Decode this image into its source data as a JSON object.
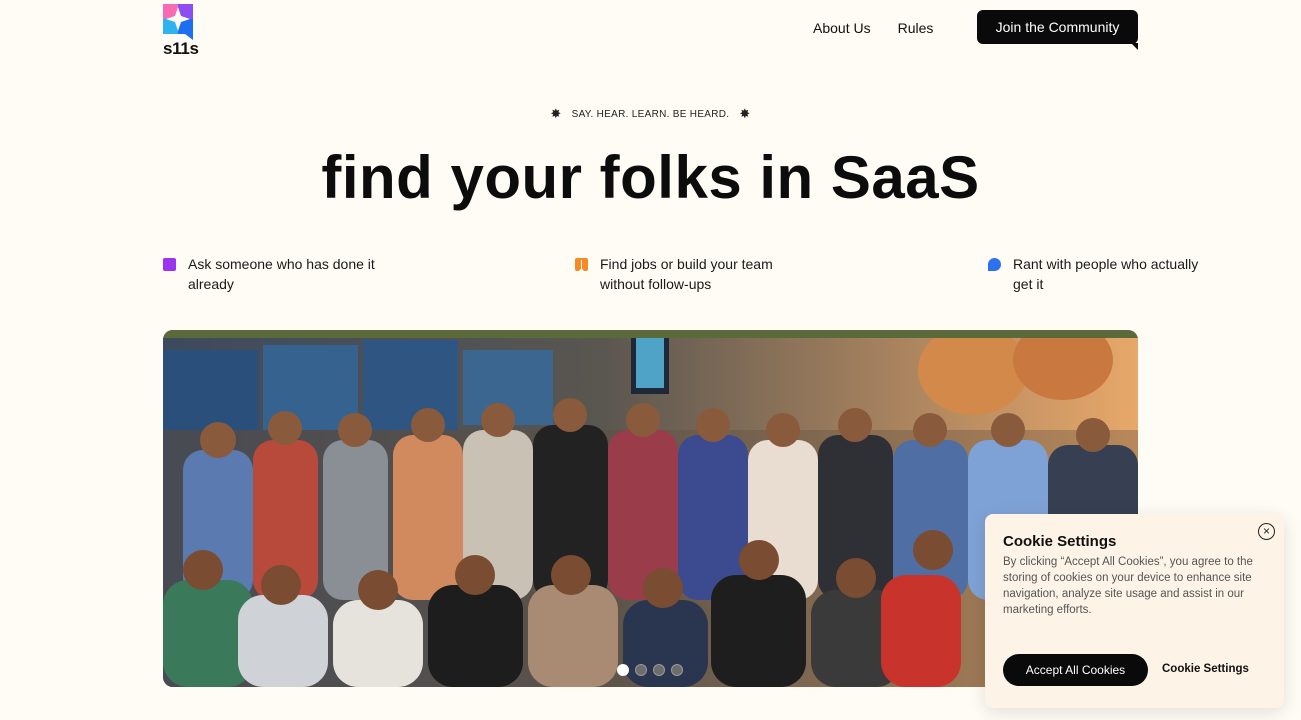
{
  "header": {
    "logo_text": "s11s",
    "nav": [
      "About Us",
      "Rules"
    ],
    "cta_label": "Join the Community"
  },
  "hero": {
    "tagline": "SAY. HEAR. LEARN. BE HEARD.",
    "headline": "find your folks in SaaS"
  },
  "features": [
    {
      "icon": "purple-square-icon",
      "color": "#9b34ef",
      "text": "Ask someone who has done it already"
    },
    {
      "icon": "orange-book-icon",
      "color": "#f58a26",
      "text": "Find jobs or build your team without follow-ups"
    },
    {
      "icon": "blue-chat-icon",
      "color": "#2d71f0",
      "text": "Rant with people who actually get it"
    }
  ],
  "carousel": {
    "slide_count": 4,
    "active_slide": 1
  },
  "cookie": {
    "title": "Cookie Settings",
    "body": "By clicking “Accept All Cookies”, you agree to the storing of cookies on your device to enhance site navigation, analyze site usage and assist in our marketing efforts.",
    "accept_label": "Accept All Cookies",
    "settings_label": "Cookie Settings",
    "close_symbol": "×"
  },
  "colors": {
    "background": "#fffbf5",
    "button": "#0a0a0a",
    "cookie_panel": "#fdf3e6"
  }
}
